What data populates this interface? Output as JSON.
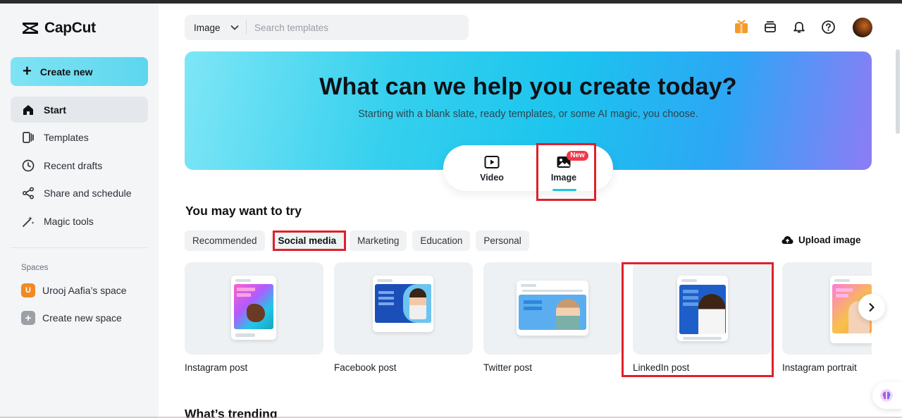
{
  "app": {
    "name": "CapCut"
  },
  "sidebar": {
    "create_label": "Create new",
    "items": [
      {
        "label": "Start",
        "icon": "home-icon",
        "active": true
      },
      {
        "label": "Templates",
        "icon": "templates-icon"
      },
      {
        "label": "Recent drafts",
        "icon": "clock-icon"
      },
      {
        "label": "Share and schedule",
        "icon": "share-icon"
      },
      {
        "label": "Magic tools",
        "icon": "magic-wand-icon"
      }
    ],
    "spaces_label": "Spaces",
    "spaces": [
      {
        "label": "Urooj Aafia’s space",
        "initial": "U"
      },
      {
        "label": "Create new space"
      }
    ]
  },
  "search": {
    "type_value": "Image",
    "placeholder": "Search templates"
  },
  "hero": {
    "title": "What can we help you create today?",
    "subtitle": "Starting with a blank slate, ready templates, or some AI magic, you choose.",
    "modes": [
      {
        "label": "Video",
        "icon": "video-play-icon"
      },
      {
        "label": "Image",
        "icon": "image-icon",
        "badge": "New",
        "selected": true
      }
    ]
  },
  "suggestions": {
    "title": "You may want to try",
    "categories": [
      "Recommended",
      "Social media",
      "Marketing",
      "Education",
      "Personal"
    ],
    "active_category": "Social media",
    "upload_label": "Upload image",
    "templates": [
      {
        "label": "Instagram post"
      },
      {
        "label": "Facebook post"
      },
      {
        "label": "Twitter post"
      },
      {
        "label": "LinkedIn post"
      },
      {
        "label": "Instagram portrait"
      }
    ]
  },
  "trending": {
    "title": "What’s trending"
  },
  "colors": {
    "accent": "#22c6dd",
    "highlight": "#e0202a",
    "badge": "#f2384a"
  }
}
